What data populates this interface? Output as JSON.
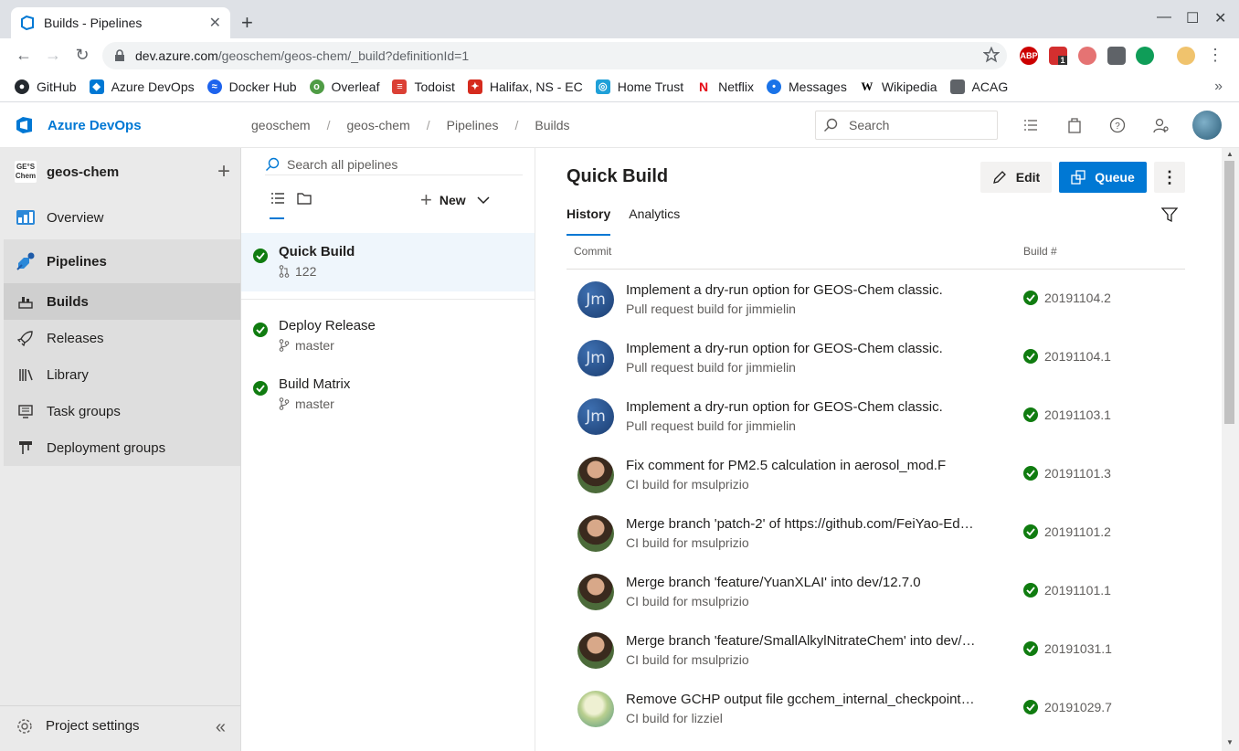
{
  "browser": {
    "tab_title": "Builds - Pipelines",
    "url_host": "dev.azure.com",
    "url_path": "/geoschem/geos-chem/_build?definitionId=1",
    "bookmarks": [
      {
        "label": "GitHub",
        "icon": "github-icon",
        "color": "#24292e"
      },
      {
        "label": "Azure DevOps",
        "icon": "azure-devops-icon",
        "color": "#0078d4"
      },
      {
        "label": "Docker Hub",
        "icon": "docker-icon",
        "color": "#1d63ed"
      },
      {
        "label": "Overleaf",
        "icon": "overleaf-icon",
        "color": "#4f9c45"
      },
      {
        "label": "Todoist",
        "icon": "todoist-icon",
        "color": "#db4035"
      },
      {
        "label": "Halifax, NS - EC",
        "icon": "maple-leaf-icon",
        "color": "#d52b1e"
      },
      {
        "label": "Home Trust",
        "icon": "home-trust-icon",
        "color": "#1fa0d8"
      },
      {
        "label": "Netflix",
        "icon": "netflix-icon",
        "color": "#e50914"
      },
      {
        "label": "Messages",
        "icon": "messages-icon",
        "color": "#1a73e8"
      },
      {
        "label": "Wikipedia",
        "icon": "wikipedia-icon",
        "color": "#000000"
      },
      {
        "label": "ACAG",
        "icon": "folder-icon",
        "color": "#5f6368"
      }
    ],
    "ext_abp": "ABP",
    "ext_badge": "1"
  },
  "header": {
    "brand": "Azure DevOps",
    "breadcrumb": [
      "geoschem",
      "geos-chem",
      "Pipelines",
      "Builds"
    ],
    "search_placeholder": "Search"
  },
  "sidebar": {
    "project_name": "geos-chem",
    "project_logo_text": "GE°S Chem",
    "items": [
      {
        "label": "Overview"
      },
      {
        "label": "Pipelines"
      },
      {
        "label": "Builds"
      },
      {
        "label": "Releases"
      },
      {
        "label": "Library"
      },
      {
        "label": "Task groups"
      },
      {
        "label": "Deployment groups"
      }
    ],
    "settings_label": "Project settings"
  },
  "pipelines_pane": {
    "search_placeholder": "Search all pipelines",
    "new_label": "New",
    "pipelines": [
      {
        "name": "Quick Build",
        "meta": "122",
        "meta_icon": "pull-request-icon",
        "status": "succeeded"
      },
      {
        "name": "Deploy Release",
        "meta": "master",
        "meta_icon": "branch-icon",
        "status": "succeeded"
      },
      {
        "name": "Build Matrix",
        "meta": "master",
        "meta_icon": "branch-icon",
        "status": "succeeded"
      }
    ]
  },
  "main": {
    "title": "Quick Build",
    "edit_label": "Edit",
    "queue_label": "Queue",
    "tabs": [
      {
        "label": "History"
      },
      {
        "label": "Analytics"
      }
    ],
    "col_commit": "Commit",
    "col_build": "Build #",
    "builds": [
      {
        "message": "Implement a dry-run option for GEOS-Chem classic.",
        "sub": "Pull request build for jimmielin",
        "number": "20191104.2",
        "avatar": "jm",
        "avatar_text": "Jm"
      },
      {
        "message": "Implement a dry-run option for GEOS-Chem classic.",
        "sub": "Pull request build for jimmielin",
        "number": "20191104.1",
        "avatar": "jm",
        "avatar_text": "Jm"
      },
      {
        "message": "Implement a dry-run option for GEOS-Chem classic.",
        "sub": "Pull request build for jimmielin",
        "number": "20191103.1",
        "avatar": "jm",
        "avatar_text": "Jm"
      },
      {
        "message": "Fix comment for PM2.5 calculation in aerosol_mod.F",
        "sub": "CI build for msulprizio",
        "number": "20191101.3",
        "avatar": "ms",
        "avatar_text": ""
      },
      {
        "message": "Merge branch 'patch-2' of https://github.com/FeiYao-Ed…",
        "sub": "CI build for msulprizio",
        "number": "20191101.2",
        "avatar": "ms",
        "avatar_text": ""
      },
      {
        "message": "Merge branch 'feature/YuanXLAI' into dev/12.7.0",
        "sub": "CI build for msulprizio",
        "number": "20191101.1",
        "avatar": "ms",
        "avatar_text": ""
      },
      {
        "message": "Merge branch 'feature/SmallAlkylNitrateChem' into dev/…",
        "sub": "CI build for msulprizio",
        "number": "20191031.1",
        "avatar": "ms",
        "avatar_text": ""
      },
      {
        "message": "Remove GCHP output file gcchem_internal_checkpoint…",
        "sub": "CI build for lizziel",
        "number": "20191029.7",
        "avatar": "lz",
        "avatar_text": ""
      }
    ]
  },
  "colors": {
    "accent": "#0078d4",
    "success": "#107c10"
  }
}
